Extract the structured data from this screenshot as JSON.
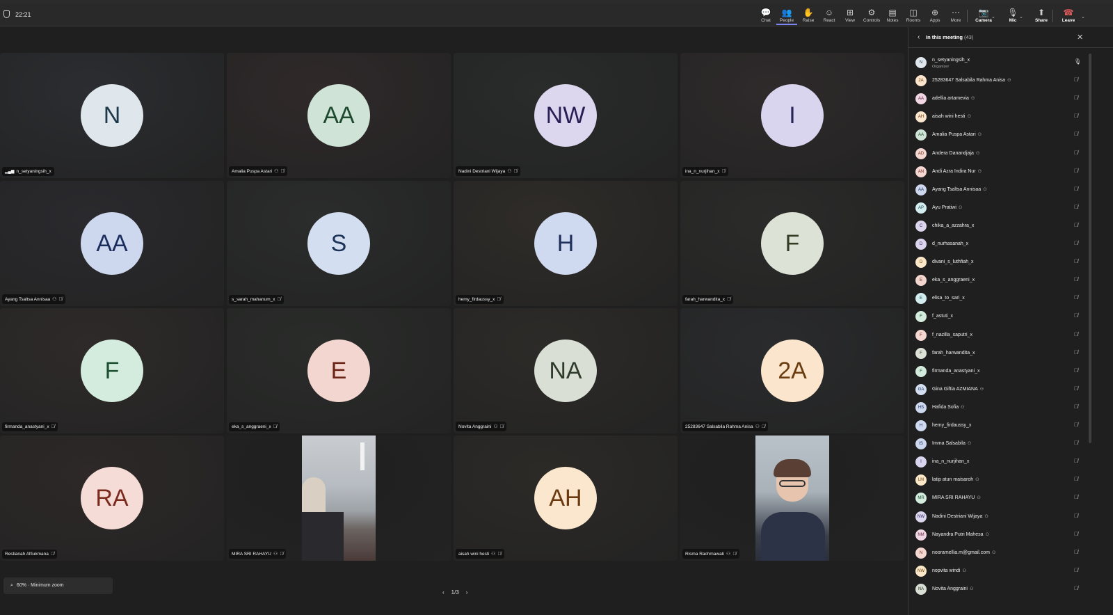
{
  "header": {
    "clock": "22:21"
  },
  "toolbar": [
    {
      "id": "chat",
      "icon": "chat-icon",
      "glyph": "💬",
      "label": "Chat"
    },
    {
      "id": "people",
      "icon": "people-icon",
      "glyph": "👥",
      "label": "People",
      "count": "43",
      "active": true
    },
    {
      "id": "raise",
      "icon": "raise-hand-icon",
      "glyph": "✋",
      "label": "Raise"
    },
    {
      "id": "react",
      "icon": "react-icon",
      "glyph": "☺",
      "label": "React"
    },
    {
      "id": "view",
      "icon": "view-icon",
      "glyph": "⊞",
      "label": "View"
    },
    {
      "id": "controls",
      "icon": "controls-icon",
      "glyph": "⚙",
      "label": "Controls"
    },
    {
      "id": "notes",
      "icon": "notes-icon",
      "glyph": "▤",
      "label": "Notes"
    },
    {
      "id": "rooms",
      "icon": "rooms-icon",
      "glyph": "◫",
      "label": "Rooms"
    },
    {
      "id": "apps",
      "icon": "apps-icon",
      "glyph": "⊕",
      "label": "Apps"
    },
    {
      "id": "more",
      "icon": "more-icon",
      "glyph": "⋯",
      "label": "More"
    },
    {
      "id": "camera",
      "icon": "camera-off-icon",
      "glyph": "📷",
      "label": "Camera",
      "bold": true
    },
    {
      "id": "mic",
      "icon": "mic-icon",
      "glyph": "🎙",
      "label": "Mic",
      "bold": true
    },
    {
      "id": "share",
      "icon": "share-icon",
      "glyph": "⬆",
      "label": "Share",
      "bold": true
    },
    {
      "id": "leave",
      "icon": "leave-icon",
      "glyph": "☎",
      "label": "Leave",
      "bold": true
    }
  ],
  "tiles": [
    {
      "name": "n_setyaningsih_x",
      "initials": "N",
      "bg": "#dfe6ec",
      "fg": "#1e3a4a",
      "signal": true,
      "muted": false,
      "spotlight": false
    },
    {
      "name": "Amalia Puspa Astari",
      "initials": "AA",
      "bg": "#cfe3d6",
      "fg": "#1d4a2e",
      "muted": true,
      "spotlight": true
    },
    {
      "name": "Nadini Destriani Wijaya",
      "initials": "NW",
      "bg": "#dcd6ee",
      "fg": "#2a1f55",
      "muted": true,
      "spotlight": true
    },
    {
      "name": "ina_n_nurjihan_x",
      "initials": "I",
      "bg": "#d9d5ee",
      "fg": "#2b2458",
      "muted": true,
      "spotlight": false
    },
    {
      "name": "Ayang Tsaltsa Annisaa",
      "initials": "AA",
      "bg": "#cdd8ee",
      "fg": "#1b2d5c",
      "muted": true,
      "spotlight": true
    },
    {
      "name": "s_sarah_mahanum_x",
      "initials": "S",
      "bg": "#d3dff0",
      "fg": "#1a3356",
      "muted": true,
      "spotlight": false
    },
    {
      "name": "hemy_firdaussy_x",
      "initials": "H",
      "bg": "#cfd9ef",
      "fg": "#1f2f5c",
      "muted": true,
      "spotlight": false
    },
    {
      "name": "farah_harwandita_x",
      "initials": "F",
      "bg": "#dde2d6",
      "fg": "#333d26",
      "muted": true,
      "spotlight": false
    },
    {
      "name": "firmanda_anastyani_x",
      "initials": "F",
      "bg": "#d4ecdd",
      "fg": "#1e5032",
      "muted": true,
      "spotlight": false
    },
    {
      "name": "eka_s_anggraeni_x",
      "initials": "E",
      "bg": "#f2d6cf",
      "fg": "#6b2415",
      "muted": true,
      "spotlight": false
    },
    {
      "name": "Novita Anggraini",
      "initials": "NA",
      "bg": "#dadfd5",
      "fg": "#2e3a2a",
      "muted": true,
      "spotlight": true
    },
    {
      "name": "25283647 Salsabila Rahma Anisa",
      "initials": "2A",
      "bg": "#fbe5cc",
      "fg": "#6a3c0f",
      "muted": true,
      "spotlight": true
    },
    {
      "name": "Restianah Alfiukmana",
      "initials": "RA",
      "bg": "#f6dcd6",
      "fg": "#7a2a1c",
      "muted": true,
      "spotlight": false
    },
    {
      "name": "MIRA SRI RAHAYU",
      "initials": "",
      "video": true,
      "muted": true,
      "spotlight": true
    },
    {
      "name": "aisah wini hesti",
      "initials": "AH",
      "bg": "#fbe6ce",
      "fg": "#6a3a10",
      "muted": true,
      "spotlight": true
    },
    {
      "name": "Risma Rachmawati",
      "initials": "",
      "video": true,
      "muted": true,
      "spotlight": true
    }
  ],
  "zoom": {
    "label": "60% · Minimum zoom"
  },
  "pager": {
    "prev": "‹",
    "label": "1/3",
    "next": "›"
  },
  "panel": {
    "title": "In this meeting",
    "count": "(43)",
    "organizer_label": "Organizer"
  },
  "participants": [
    {
      "name": "n_setyaningsih_x",
      "initials": "N",
      "bg": "#dfe6ec",
      "fg": "#1e3a4a",
      "organizer": true,
      "mic": "on"
    },
    {
      "name": "25283647 Salsabila Rahma Anisa",
      "initials": "2A",
      "bg": "#fbe5cc",
      "fg": "#6a3c0f",
      "spotlight": true
    },
    {
      "name": "adellia artamevia",
      "initials": "AA",
      "bg": "#f1d6e4",
      "fg": "#5a1f3d",
      "spotlight": true
    },
    {
      "name": "aisah wini hesti",
      "initials": "AH",
      "bg": "#fbe6ce",
      "fg": "#6a3a10",
      "spotlight": true
    },
    {
      "name": "Amalia Puspa Astari",
      "initials": "AA",
      "bg": "#cfe3d6",
      "fg": "#1d4a2e",
      "spotlight": true
    },
    {
      "name": "Andera Danandjaja",
      "initials": "AD",
      "bg": "#f6d8d3",
      "fg": "#6e2a1c",
      "spotlight": true
    },
    {
      "name": "Andi Azra Indira Nur",
      "initials": "AN",
      "bg": "#f6d8d3",
      "fg": "#6e2a1c",
      "spotlight": true
    },
    {
      "name": "Ayang Tsaltsa Annisaa",
      "initials": "AA",
      "bg": "#cdd8ee",
      "fg": "#1b2d5c",
      "spotlight": true
    },
    {
      "name": "Ayu Pratiwi",
      "initials": "AP",
      "bg": "#d3ecf0",
      "fg": "#1a4a52",
      "spotlight": true
    },
    {
      "name": "chika_a_azzahra_x",
      "initials": "C",
      "bg": "#ddd5ee",
      "fg": "#2d2458"
    },
    {
      "name": "d_nurhasanah_x",
      "initials": "D",
      "bg": "#ddd5ee",
      "fg": "#2d2458"
    },
    {
      "name": "divani_s_luthfiah_x",
      "initials": "D",
      "bg": "#fbe8c8",
      "fg": "#6a4510"
    },
    {
      "name": "eka_s_anggraeni_x",
      "initials": "E",
      "bg": "#f2d6cf",
      "fg": "#6b2415"
    },
    {
      "name": "elisa_to_sari_x",
      "initials": "E",
      "bg": "#d3ecf0",
      "fg": "#1a4a52"
    },
    {
      "name": "f_astuti_x",
      "initials": "F",
      "bg": "#d4ecdd",
      "fg": "#1e5032"
    },
    {
      "name": "f_nazilla_saputri_x",
      "initials": "F",
      "bg": "#f6d8d3",
      "fg": "#6e2a1c"
    },
    {
      "name": "farah_harwandita_x",
      "initials": "F",
      "bg": "#dde2d6",
      "fg": "#333d26"
    },
    {
      "name": "firmanda_anastyani_x",
      "initials": "F",
      "bg": "#d4ecdd",
      "fg": "#1e5032"
    },
    {
      "name": "Gina Giftia AZMIANA",
      "initials": "GA",
      "bg": "#d3dff0",
      "fg": "#1a3356",
      "spotlight": true
    },
    {
      "name": "Hafida Sofia",
      "initials": "HS",
      "bg": "#cdd8ee",
      "fg": "#1b2d5c",
      "spotlight": true
    },
    {
      "name": "hemy_firdaussy_x",
      "initials": "H",
      "bg": "#cfd9ef",
      "fg": "#1f2f5c"
    },
    {
      "name": "Imma Salsabila",
      "initials": "IS",
      "bg": "#cdd8ee",
      "fg": "#1b2d5c",
      "spotlight": true
    },
    {
      "name": "ina_n_nurjihan_x",
      "initials": "I",
      "bg": "#d9d5ee",
      "fg": "#2b2458"
    },
    {
      "name": "latip atun maisaroh",
      "initials": "LM",
      "bg": "#fbe8c8",
      "fg": "#6a4510",
      "spotlight": true
    },
    {
      "name": "MIRA SRI RAHAYU",
      "initials": "MR",
      "bg": "#d4ecdd",
      "fg": "#1e5032",
      "spotlight": true
    },
    {
      "name": "Nadini Destriani Wijaya",
      "initials": "NW",
      "bg": "#dcd6ee",
      "fg": "#2a1f55",
      "spotlight": true
    },
    {
      "name": "Nayandra Putri Mahesa",
      "initials": "NM",
      "bg": "#f1d6e4",
      "fg": "#5a1f3d",
      "spotlight": true
    },
    {
      "name": "nooramellia.m@gmail.com",
      "initials": "N",
      "bg": "#f6d8d3",
      "fg": "#6e2a1c",
      "spotlight": true
    },
    {
      "name": "nopvita windi",
      "initials": "NW",
      "bg": "#fbe8c8",
      "fg": "#6a4510",
      "spotlight": true
    },
    {
      "name": "Novita Anggraini",
      "initials": "NA",
      "bg": "#dadfd5",
      "fg": "#2e3a2a",
      "spotlight": true
    }
  ],
  "colors": {
    "accent": "#7f85f5",
    "leave": "#c4314b"
  }
}
